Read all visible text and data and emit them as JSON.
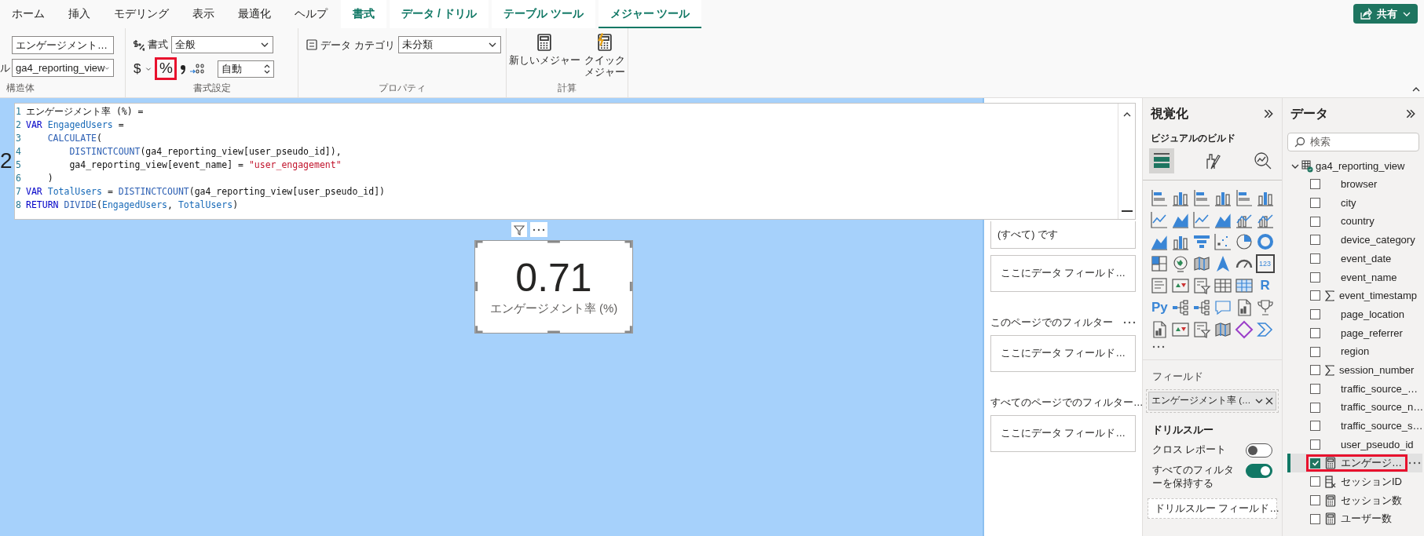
{
  "ribbon_tabs": [
    {
      "label": "ホーム",
      "kind": "standard",
      "selected": false
    },
    {
      "label": "挿入",
      "kind": "standard",
      "selected": false
    },
    {
      "label": "モデリング",
      "kind": "standard",
      "selected": false
    },
    {
      "label": "表示",
      "kind": "standard",
      "selected": false
    },
    {
      "label": "最適化",
      "kind": "standard",
      "selected": false
    },
    {
      "label": "ヘルプ",
      "kind": "standard",
      "selected": false
    },
    {
      "label": "書式",
      "kind": "contextual",
      "selected": false
    },
    {
      "label": "データ / ドリル",
      "kind": "contextual",
      "selected": false
    },
    {
      "label": "テーブル ツール",
      "kind": "contextual",
      "selected": false
    },
    {
      "label": "メジャー ツール",
      "kind": "contextual",
      "selected": true
    }
  ],
  "share_button": {
    "label": "共有"
  },
  "ribbon": {
    "structure": {
      "name_field": "エンゲージメント…",
      "table_label": "ル",
      "table_dropdown": "ga4_reporting_view",
      "group_label": "構造体"
    },
    "formatting": {
      "format_label": "書式",
      "format_dropdown": "全般",
      "currency_symbol": "$",
      "percent_symbol": "%",
      "percent_annotated": true,
      "decimal_field": "自動",
      "group_label": "書式設定"
    },
    "properties": {
      "category_label": "データ カテゴリ",
      "category_dropdown": "未分類",
      "group_label": "プロパティ"
    },
    "calculations": {
      "buttons": [
        {
          "label": "新しいメジャー",
          "kind": "calculator"
        },
        {
          "label": "クイックメジャー",
          "kind": "quick"
        }
      ],
      "group_label": "計算"
    }
  },
  "formula_bar": {
    "lines": [
      {
        "number": "1",
        "segments": [
          {
            "kind": "plain",
            "text": "エンゲージメント率 (%) ="
          }
        ]
      },
      {
        "number": "2",
        "segments": [
          {
            "kind": "keyword",
            "text": "VAR"
          },
          {
            "kind": "variable",
            "text": " EngagedUsers"
          },
          {
            "kind": "plain",
            "text": " ="
          }
        ]
      },
      {
        "number": "3",
        "segments": [
          {
            "kind": "function",
            "text": "    CALCULATE"
          },
          {
            "kind": "plain",
            "text": "("
          }
        ]
      },
      {
        "number": "4",
        "segments": [
          {
            "kind": "function",
            "text": "        DISTINCTCOUNT"
          },
          {
            "kind": "plain",
            "text": "(ga4_reporting_view[user_pseudo_id]),"
          }
        ]
      },
      {
        "number": "5",
        "segments": [
          {
            "kind": "plain",
            "text": "        ga4_reporting_view[event_name] = "
          },
          {
            "kind": "string",
            "text": "\"user_engagement\""
          }
        ]
      },
      {
        "number": "6",
        "segments": [
          {
            "kind": "plain",
            "text": "    )"
          }
        ]
      },
      {
        "number": "7",
        "segments": [
          {
            "kind": "keyword",
            "text": "VAR"
          },
          {
            "kind": "variable",
            "text": " TotalUsers"
          },
          {
            "kind": "plain",
            "text": " = "
          },
          {
            "kind": "function",
            "text": "DISTINCTCOUNT"
          },
          {
            "kind": "plain",
            "text": "(ga4_reporting_view[user_pseudo_id])"
          }
        ]
      },
      {
        "number": "8",
        "segments": [
          {
            "kind": "keyword",
            "text": "RETURN"
          },
          {
            "kind": "function",
            "text": " DIVIDE"
          },
          {
            "kind": "plain",
            "text": "("
          },
          {
            "kind": "variable",
            "text": "EngagedUsers"
          },
          {
            "kind": "plain",
            "text": ", "
          },
          {
            "kind": "variable",
            "text": "TotalUsers"
          },
          {
            "kind": "plain",
            "text": ")"
          }
        ]
      }
    ]
  },
  "canvas": {
    "left_fragment": "2",
    "card": {
      "value": "0.71",
      "label": "エンゲージメント率 (%)",
      "selected": true
    }
  },
  "filters": {
    "visual_cards": [
      "(すべて) です",
      "ここにデータ フィールド…"
    ],
    "sections": [
      {
        "title": "このページでのフィルター",
        "card": "ここにデータ フィールド…"
      },
      {
        "title": "すべてのページでのフィルター…",
        "card": "ここにデータ フィールド…"
      }
    ]
  },
  "visualizations": {
    "title": "視覚化",
    "subtitle": "ビジュアルのビルド",
    "build_modes": [
      {
        "kind": "fields",
        "selected": true
      },
      {
        "kind": "format",
        "selected": false
      },
      {
        "kind": "analytics",
        "selected": false
      }
    ],
    "visual_types": [
      {
        "kind": "hbar"
      },
      {
        "kind": "vbar"
      },
      {
        "kind": "hbar"
      },
      {
        "kind": "vbar"
      },
      {
        "kind": "hbar"
      },
      {
        "kind": "vbar"
      },
      {
        "kind": "line"
      },
      {
        "kind": "area"
      },
      {
        "kind": "line"
      },
      {
        "kind": "area"
      },
      {
        "kind": "combo"
      },
      {
        "kind": "combo"
      },
      {
        "kind": "area"
      },
      {
        "kind": "vbar"
      },
      {
        "kind": "funnel"
      },
      {
        "kind": "scatter"
      },
      {
        "kind": "pie"
      },
      {
        "kind": "donut"
      },
      {
        "kind": "treemap"
      },
      {
        "kind": "globe"
      },
      {
        "kind": "map"
      },
      {
        "kind": "arrow"
      },
      {
        "kind": "gauge"
      },
      {
        "kind": "card",
        "label": "123"
      },
      {
        "kind": "list"
      },
      {
        "kind": "kpi"
      },
      {
        "kind": "slicer"
      },
      {
        "kind": "table"
      },
      {
        "kind": "matrix"
      },
      {
        "kind": "letter",
        "label": "R"
      },
      {
        "kind": "letter",
        "label": "Py"
      },
      {
        "kind": "tree"
      },
      {
        "kind": "tree"
      },
      {
        "kind": "speech"
      },
      {
        "kind": "doc"
      },
      {
        "kind": "trophy"
      },
      {
        "kind": "doc"
      },
      {
        "kind": "kpi"
      },
      {
        "kind": "slicer"
      },
      {
        "kind": "map"
      },
      {
        "kind": "diamond"
      },
      {
        "kind": "chevrons"
      }
    ],
    "fields_label": "フィールド",
    "field_chip": "エンゲージメント率 (…",
    "drillthrough": {
      "title": "ドリルスルー",
      "options": [
        {
          "label": "クロス レポート",
          "on": false
        },
        {
          "label": "すべてのフィルターを保持する",
          "on": true
        }
      ],
      "placeholder": "ドリルスルー フィールド…"
    }
  },
  "data": {
    "title": "データ",
    "search": {
      "placeholder": "検索"
    },
    "tables": [
      {
        "name": "ga4_reporting_view",
        "expanded": true,
        "fields": [
          {
            "name": "browser",
            "kind": "column",
            "checked": false,
            "selected": false,
            "annotated": false
          },
          {
            "name": "city",
            "kind": "column",
            "checked": false,
            "selected": false,
            "annotated": false
          },
          {
            "name": "country",
            "kind": "column",
            "checked": false,
            "selected": false,
            "annotated": false
          },
          {
            "name": "device_category",
            "kind": "column",
            "checked": false,
            "selected": false,
            "annotated": false
          },
          {
            "name": "event_date",
            "kind": "column",
            "checked": false,
            "selected": false,
            "annotated": false
          },
          {
            "name": "event_name",
            "kind": "column",
            "checked": false,
            "selected": false,
            "annotated": false
          },
          {
            "name": "event_timestamp",
            "kind": "sum",
            "checked": false,
            "selected": false,
            "annotated": false
          },
          {
            "name": "page_location",
            "kind": "column",
            "checked": false,
            "selected": false,
            "annotated": false
          },
          {
            "name": "page_referrer",
            "kind": "column",
            "checked": false,
            "selected": false,
            "annotated": false
          },
          {
            "name": "region",
            "kind": "column",
            "checked": false,
            "selected": false,
            "annotated": false
          },
          {
            "name": "session_number",
            "kind": "sum",
            "checked": false,
            "selected": false,
            "annotated": false
          },
          {
            "name": "traffic_source_…",
            "kind": "column",
            "checked": false,
            "selected": false,
            "annotated": false
          },
          {
            "name": "traffic_source_n…",
            "kind": "column",
            "checked": false,
            "selected": false,
            "annotated": false
          },
          {
            "name": "traffic_source_s…",
            "kind": "column",
            "checked": false,
            "selected": false,
            "annotated": false
          },
          {
            "name": "user_pseudo_id",
            "kind": "column",
            "checked": false,
            "selected": false,
            "annotated": false
          },
          {
            "name": "エンゲージ…",
            "kind": "measure",
            "checked": true,
            "selected": true,
            "annotated": true
          },
          {
            "name": "セッションID",
            "kind": "calc_column",
            "checked": false,
            "selected": false,
            "annotated": false
          },
          {
            "name": "セッション数",
            "kind": "measure",
            "checked": false,
            "selected": false,
            "annotated": false
          },
          {
            "name": "ユーザー数",
            "kind": "measure",
            "checked": false,
            "selected": false,
            "annotated": false
          }
        ]
      }
    ]
  }
}
